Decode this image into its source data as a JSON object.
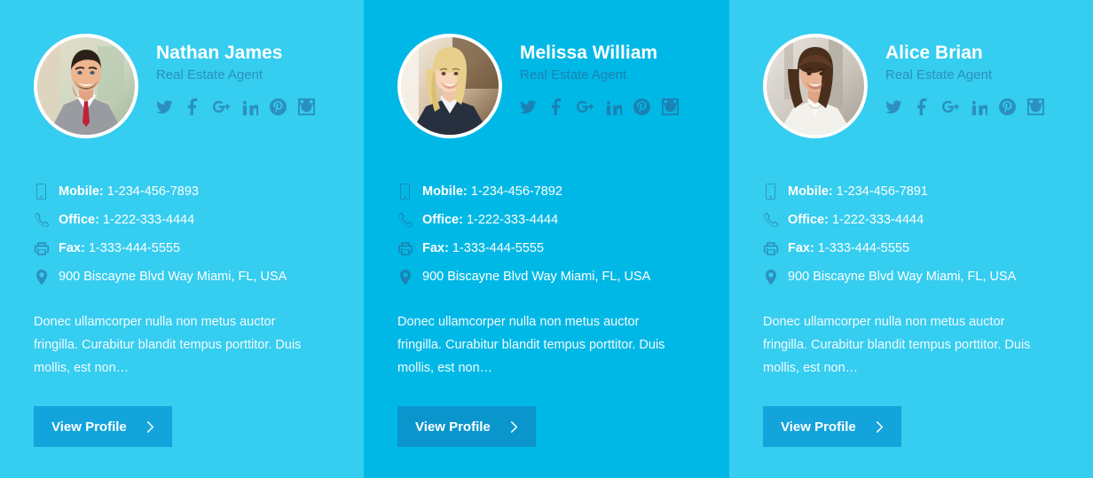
{
  "theme": {
    "bg_light": "#35cdf0",
    "bg_dark": "#00b8e6",
    "button_light": "#12a4db",
    "button_dark": "#0a96cc",
    "muted_text": "#2b90bf",
    "text": "#ffffff"
  },
  "labels": {
    "mobile": "Mobile:",
    "office": "Office:",
    "fax": "Fax:",
    "view_profile": "View Profile"
  },
  "social_networks": [
    "twitter-icon",
    "facebook-icon",
    "google-plus-icon",
    "linkedin-icon",
    "pinterest-icon",
    "instagram-icon"
  ],
  "cards": [
    {
      "name": "Nathan James",
      "role": "Real Estate Agent",
      "mobile": "1-234-456-7893",
      "office": "1-222-333-4444",
      "fax": "1-333-444-5555",
      "address": "900 Biscayne Blvd Way Miami, FL, USA",
      "description": "Donec ullamcorper nulla non metus auctor fringilla. Curabitur blandit tempus porttitor. Duis mollis, est non…",
      "button": "View Profile",
      "avatar_alt": "male-agent-portrait"
    },
    {
      "name": "Melissa William",
      "role": "Real Estate Agent",
      "mobile": "1-234-456-7892",
      "office": "1-222-333-4444",
      "fax": "1-333-444-5555",
      "address": "900 Biscayne Blvd Way Miami, FL, USA",
      "description": "Donec ullamcorper nulla non metus auctor fringilla. Curabitur blandit tempus porttitor. Duis mollis, est non…",
      "button": "View Profile",
      "avatar_alt": "blonde-female-agent-portrait"
    },
    {
      "name": "Alice Brian",
      "role": "Real Estate Agent",
      "mobile": "1-234-456-7891",
      "office": "1-222-333-4444",
      "fax": "1-333-444-5555",
      "address": "900 Biscayne Blvd Way Miami, FL, USA",
      "description": "Donec ullamcorper nulla non metus auctor fringilla. Curabitur blandit tempus porttitor. Duis mollis, est non…",
      "button": "View Profile",
      "avatar_alt": "brunette-female-agent-portrait"
    }
  ]
}
